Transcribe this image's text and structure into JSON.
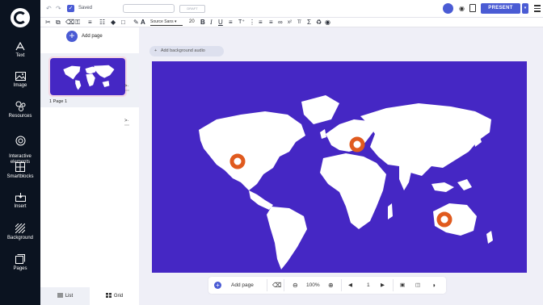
{
  "sidebar": {
    "items": [
      {
        "label": "Text",
        "icon": "text-icon"
      },
      {
        "label": "Image",
        "icon": "image-icon"
      },
      {
        "label": "Resources",
        "icon": "resources-icon"
      },
      {
        "label": "Interactive\nelements",
        "icon": "interactive-icon"
      },
      {
        "label": "Smartblocks",
        "icon": "smartblocks-icon"
      },
      {
        "label": "Insert",
        "icon": "insert-icon"
      },
      {
        "label": "Background",
        "icon": "background-icon"
      },
      {
        "label": "Pages",
        "icon": "pages-icon"
      }
    ]
  },
  "topbar": {
    "saved_label": "Saved",
    "title_value": "",
    "draft_label": "DRAFT",
    "avatar_initial": "",
    "present_label": "PRESENT"
  },
  "format": {
    "font_name": "Source Sans",
    "font_size": "20"
  },
  "panel": {
    "add_page_label": "Add page",
    "pages": [
      {
        "label": "1  Page 1"
      }
    ],
    "tabs": [
      {
        "label": "List",
        "active": true
      },
      {
        "label": "Grid",
        "active": false
      }
    ]
  },
  "canvas": {
    "audio_label": "Add background audio",
    "background_color": "#4527c4",
    "marker_color": "#e05a1e",
    "markers": [
      "north-america",
      "europe",
      "australia"
    ]
  },
  "bottombar": {
    "add_page_label": "Add page",
    "zoom_label": "100%",
    "page_number": "1"
  },
  "colors": {
    "accent": "#4a5bd4",
    "sidebar": "#0b1320",
    "map_background": "#4527c4",
    "marker": "#e05a1e"
  }
}
